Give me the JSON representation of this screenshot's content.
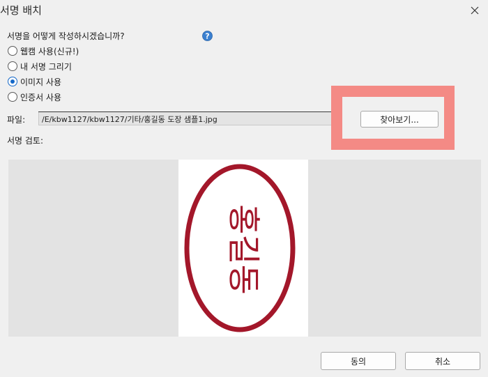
{
  "window": {
    "title": "서명 배치"
  },
  "prompt": {
    "question": "서명을 어떻게 작성하시겠습니까?"
  },
  "options": [
    {
      "label": "웹캠 사용(신규!)",
      "selected": false
    },
    {
      "label": "내 서명 그리기",
      "selected": false
    },
    {
      "label": "이미지 사용",
      "selected": true
    },
    {
      "label": "인증서 사용",
      "selected": false
    }
  ],
  "file": {
    "label": "파일:",
    "path": "/E/kbw1127/kbw1127/기타/홍길동 도장 샘플1.jpg",
    "browse_label": "찾아보기..."
  },
  "review": {
    "label": "서명 검토:",
    "stamp_text": "홍길동"
  },
  "buttons": {
    "agree": "동의",
    "cancel": "취소"
  },
  "colors": {
    "stamp_red": "#a3172a",
    "accent": "#1468c8",
    "highlight": "#f48a85"
  }
}
